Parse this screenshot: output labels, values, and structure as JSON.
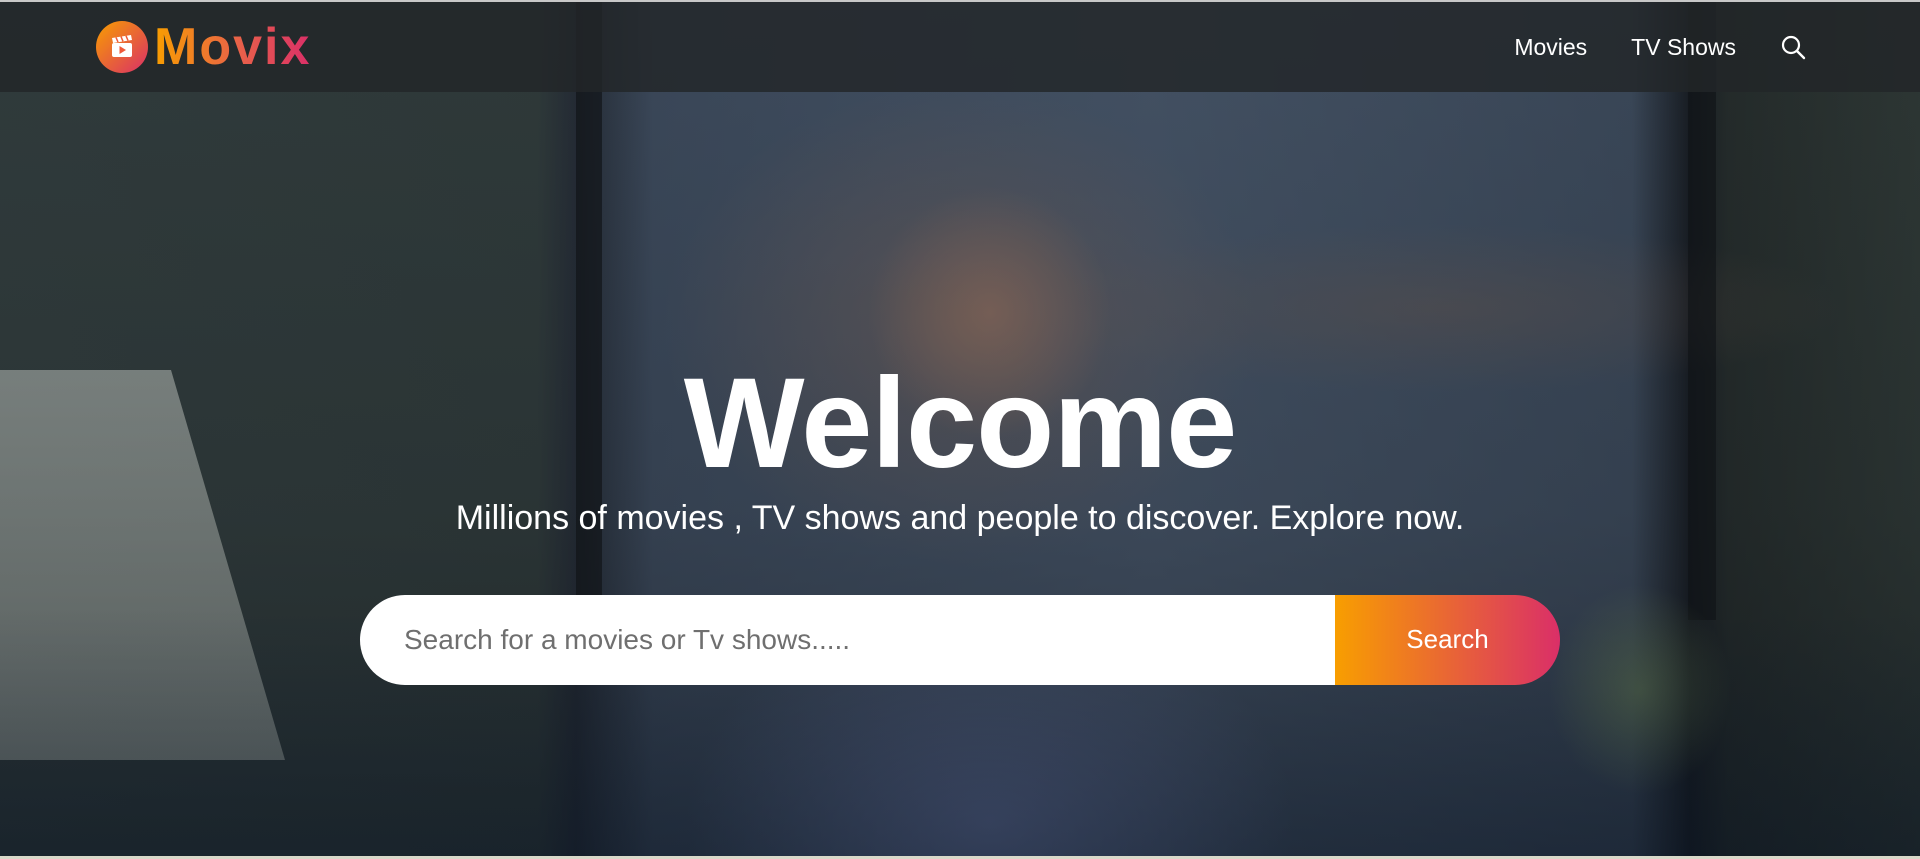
{
  "header": {
    "logo_text": "Movix",
    "logo_icon": "clapperboard-play-icon",
    "nav": [
      {
        "label": "Movies"
      },
      {
        "label": "TV Shows"
      }
    ],
    "search_icon": "search-icon"
  },
  "hero": {
    "title": "Welcome",
    "subtitle": "Millions of movies , TV shows and people to discover. Explore now.",
    "search": {
      "placeholder": "Search for a movies or Tv shows.....",
      "value": "",
      "button_label": "Search"
    }
  },
  "colors": {
    "accent_orange": "#f89e00",
    "accent_pink": "#da2f68",
    "header_bg": "#222628",
    "text": "#ffffff"
  }
}
